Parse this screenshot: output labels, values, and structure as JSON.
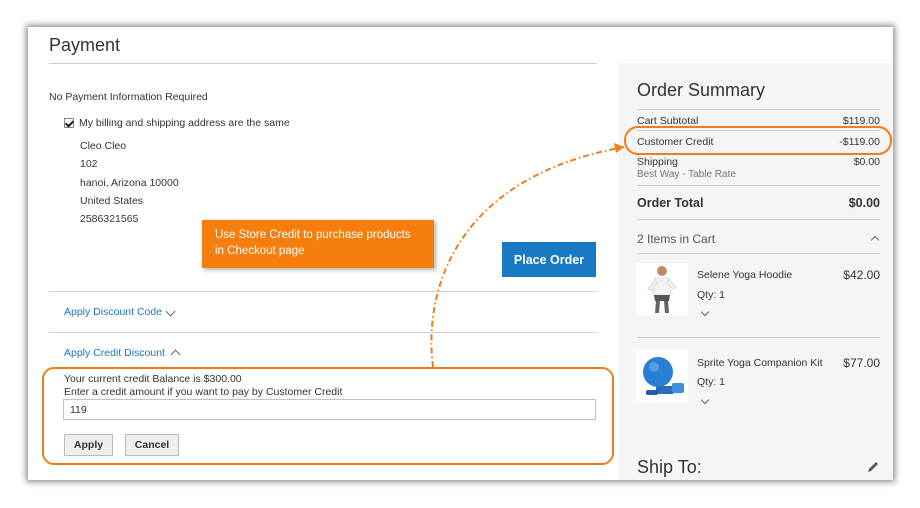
{
  "payment": {
    "title": "Payment",
    "no_payment_info": "No Payment Information Required",
    "billing_same_label": "My billing and shipping address are the same",
    "address": {
      "name": "Cleo Cleo",
      "street": "102",
      "city_line": "hanoi, Arizona 10000",
      "country": "United States",
      "phone": "2586321565"
    },
    "place_order_label": "Place Order",
    "apply_discount_label": "Apply Discount Code",
    "apply_credit_label": "Apply Credit Discount",
    "credit_balance_text": "Your current credit Balance is $300.00",
    "credit_hint_text": "Enter a credit amount if you want to pay by Customer Credit",
    "credit_input_value": "119",
    "apply_label": "Apply",
    "cancel_label": "Cancel"
  },
  "callout": {
    "line1": "Use Store Credit to purchase products",
    "line2": "in Checkout page"
  },
  "summary": {
    "title": "Order Summary",
    "cart_subtotal_label": "Cart Subtotal",
    "cart_subtotal_value": "$119.00",
    "customer_credit_label": "Customer Credit",
    "customer_credit_value": "-$119.00",
    "shipping_label": "Shipping",
    "shipping_value": "$0.00",
    "shipping_method": "Best Way - Table Rate",
    "order_total_label": "Order Total",
    "order_total_value": "$0.00",
    "items_in_cart": "2 Items in Cart",
    "items": [
      {
        "name": "Selene Yoga Hoodie",
        "price": "$42.00",
        "qty": "Qty: 1"
      },
      {
        "name": "Sprite Yoga Companion Kit",
        "price": "$77.00",
        "qty": "Qty: 1"
      }
    ],
    "ship_to_title": "Ship To:"
  },
  "colors": {
    "accent": "#1979c3",
    "annotation": "#f07c1b",
    "callout_bg": "#f57e0f"
  }
}
